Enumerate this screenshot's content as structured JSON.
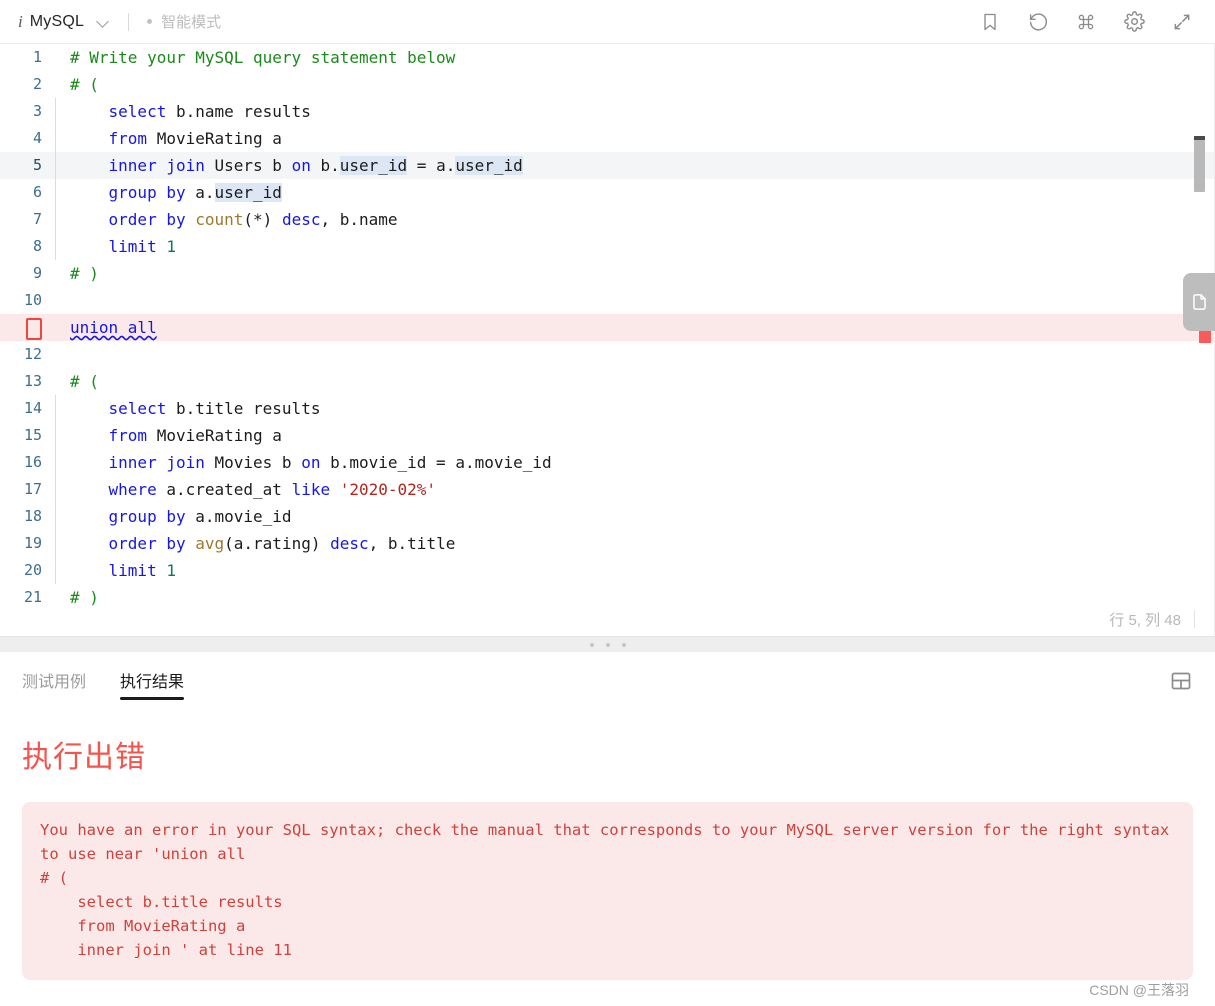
{
  "topbar": {
    "info_icon": "info-italic-i-icon",
    "language": "MySQL",
    "dropdown_icon": "chevron-down-icon",
    "mode_label": "智能模式",
    "icons": [
      {
        "name": "bookmark-icon",
        "label": "bookmark"
      },
      {
        "name": "history-undo-icon",
        "label": "history"
      },
      {
        "name": "command-icon",
        "label": "command"
      },
      {
        "name": "gear-icon",
        "label": "settings"
      },
      {
        "name": "expand-icon",
        "label": "fullscreen"
      }
    ]
  },
  "editor": {
    "status_position": "行 5, 列 48",
    "side_tab_icon": "document-notes-icon",
    "error_marker_icon": "error-box-icon",
    "lines": [
      {
        "no": "1",
        "state": "normal",
        "indent": 0,
        "tokens": [
          {
            "t": "# Write your MySQL query statement below",
            "c": "cmt"
          }
        ]
      },
      {
        "no": "2",
        "state": "normal",
        "indent": 0,
        "tokens": [
          {
            "t": "# (",
            "c": "cmt"
          }
        ]
      },
      {
        "no": "3",
        "state": "normal",
        "indent": 1,
        "tokens": [
          {
            "t": "    "
          },
          {
            "t": "select",
            "c": "kw"
          },
          {
            "t": " b.name results"
          }
        ]
      },
      {
        "no": "4",
        "state": "normal",
        "indent": 1,
        "tokens": [
          {
            "t": "    "
          },
          {
            "t": "from",
            "c": "kw"
          },
          {
            "t": " MovieRating a"
          }
        ]
      },
      {
        "no": "5",
        "state": "current",
        "indent": 1,
        "tokens": [
          {
            "t": "    "
          },
          {
            "t": "inner join",
            "c": "kw"
          },
          {
            "t": " Users b "
          },
          {
            "t": "on",
            "c": "kw"
          },
          {
            "t": " b."
          },
          {
            "t": "user_id",
            "c": "sel"
          },
          {
            "t": " = a."
          },
          {
            "t": "user_id",
            "c": "sel"
          }
        ]
      },
      {
        "no": "6",
        "state": "normal",
        "indent": 1,
        "tokens": [
          {
            "t": "    "
          },
          {
            "t": "group by",
            "c": "kw"
          },
          {
            "t": " a."
          },
          {
            "t": "user_id",
            "c": "sel"
          }
        ]
      },
      {
        "no": "7",
        "state": "normal",
        "indent": 1,
        "tokens": [
          {
            "t": "    "
          },
          {
            "t": "order by",
            "c": "kw"
          },
          {
            "t": " "
          },
          {
            "t": "count",
            "c": "fn"
          },
          {
            "t": "(*) "
          },
          {
            "t": "desc",
            "c": "kw"
          },
          {
            "t": ", b.name"
          }
        ]
      },
      {
        "no": "8",
        "state": "normal",
        "indent": 1,
        "tokens": [
          {
            "t": "    "
          },
          {
            "t": "limit",
            "c": "kw"
          },
          {
            "t": " "
          },
          {
            "t": "1",
            "c": "num"
          }
        ]
      },
      {
        "no": "9",
        "state": "normal",
        "indent": 0,
        "tokens": [
          {
            "t": "# )",
            "c": "cmt"
          }
        ]
      },
      {
        "no": "10",
        "state": "normal",
        "indent": 0,
        "tokens": [
          {
            "t": ""
          }
        ]
      },
      {
        "no": "",
        "state": "error",
        "indent": 0,
        "tokens": [
          {
            "t": "union all",
            "c": "kw squig u-line"
          }
        ]
      },
      {
        "no": "12",
        "state": "normal",
        "indent": 0,
        "tokens": [
          {
            "t": ""
          }
        ]
      },
      {
        "no": "13",
        "state": "normal",
        "indent": 0,
        "tokens": [
          {
            "t": "# (",
            "c": "cmt"
          }
        ]
      },
      {
        "no": "14",
        "state": "normal",
        "indent": 1,
        "tokens": [
          {
            "t": "    "
          },
          {
            "t": "select",
            "c": "kw"
          },
          {
            "t": " b.title results"
          }
        ]
      },
      {
        "no": "15",
        "state": "normal",
        "indent": 1,
        "tokens": [
          {
            "t": "    "
          },
          {
            "t": "from",
            "c": "kw"
          },
          {
            "t": " MovieRating a"
          }
        ]
      },
      {
        "no": "16",
        "state": "normal",
        "indent": 1,
        "tokens": [
          {
            "t": "    "
          },
          {
            "t": "inner join",
            "c": "kw"
          },
          {
            "t": " Movies b "
          },
          {
            "t": "on",
            "c": "kw"
          },
          {
            "t": " b.movie_id = a.movie_id"
          }
        ]
      },
      {
        "no": "17",
        "state": "normal",
        "indent": 1,
        "tokens": [
          {
            "t": "    "
          },
          {
            "t": "where",
            "c": "kw"
          },
          {
            "t": " a.created_at "
          },
          {
            "t": "like",
            "c": "kw"
          },
          {
            "t": " "
          },
          {
            "t": "'2020-02%'",
            "c": "str"
          }
        ]
      },
      {
        "no": "18",
        "state": "normal",
        "indent": 1,
        "tokens": [
          {
            "t": "    "
          },
          {
            "t": "group by",
            "c": "kw"
          },
          {
            "t": " a.movie_id"
          }
        ]
      },
      {
        "no": "19",
        "state": "normal",
        "indent": 1,
        "tokens": [
          {
            "t": "    "
          },
          {
            "t": "order by",
            "c": "kw"
          },
          {
            "t": " "
          },
          {
            "t": "avg",
            "c": "fn"
          },
          {
            "t": "(a.rating) "
          },
          {
            "t": "desc",
            "c": "kw"
          },
          {
            "t": ", b.title"
          }
        ]
      },
      {
        "no": "20",
        "state": "normal",
        "indent": 1,
        "tokens": [
          {
            "t": "    "
          },
          {
            "t": "limit",
            "c": "kw"
          },
          {
            "t": " "
          },
          {
            "t": "1",
            "c": "num"
          }
        ]
      },
      {
        "no": "21",
        "state": "normal",
        "indent": 0,
        "tokens": [
          {
            "t": "# )",
            "c": "cmt"
          }
        ]
      }
    ]
  },
  "results": {
    "tabs": [
      {
        "label": "测试用例",
        "active": false
      },
      {
        "label": "执行结果",
        "active": true
      }
    ],
    "layout_icon": "split-layout-icon",
    "error_title": "执行出错",
    "error_message": "You have an error in your SQL syntax; check the manual that corresponds to your MySQL server version for the right syntax to use near 'union all\n# (\n    select b.title results\n    from MovieRating a\n    inner join ' at line 11",
    "watermark": "CSDN @王落羽"
  },
  "colors": {
    "error_red": "#f4544b",
    "error_bg": "#fbe9e9",
    "keyword_blue": "#1616e6",
    "comment_green": "#1a8a1a",
    "string_red": "#b3261e",
    "gutter_blue": "#3d6e8f",
    "accent_dark": "#1a1a1a"
  }
}
